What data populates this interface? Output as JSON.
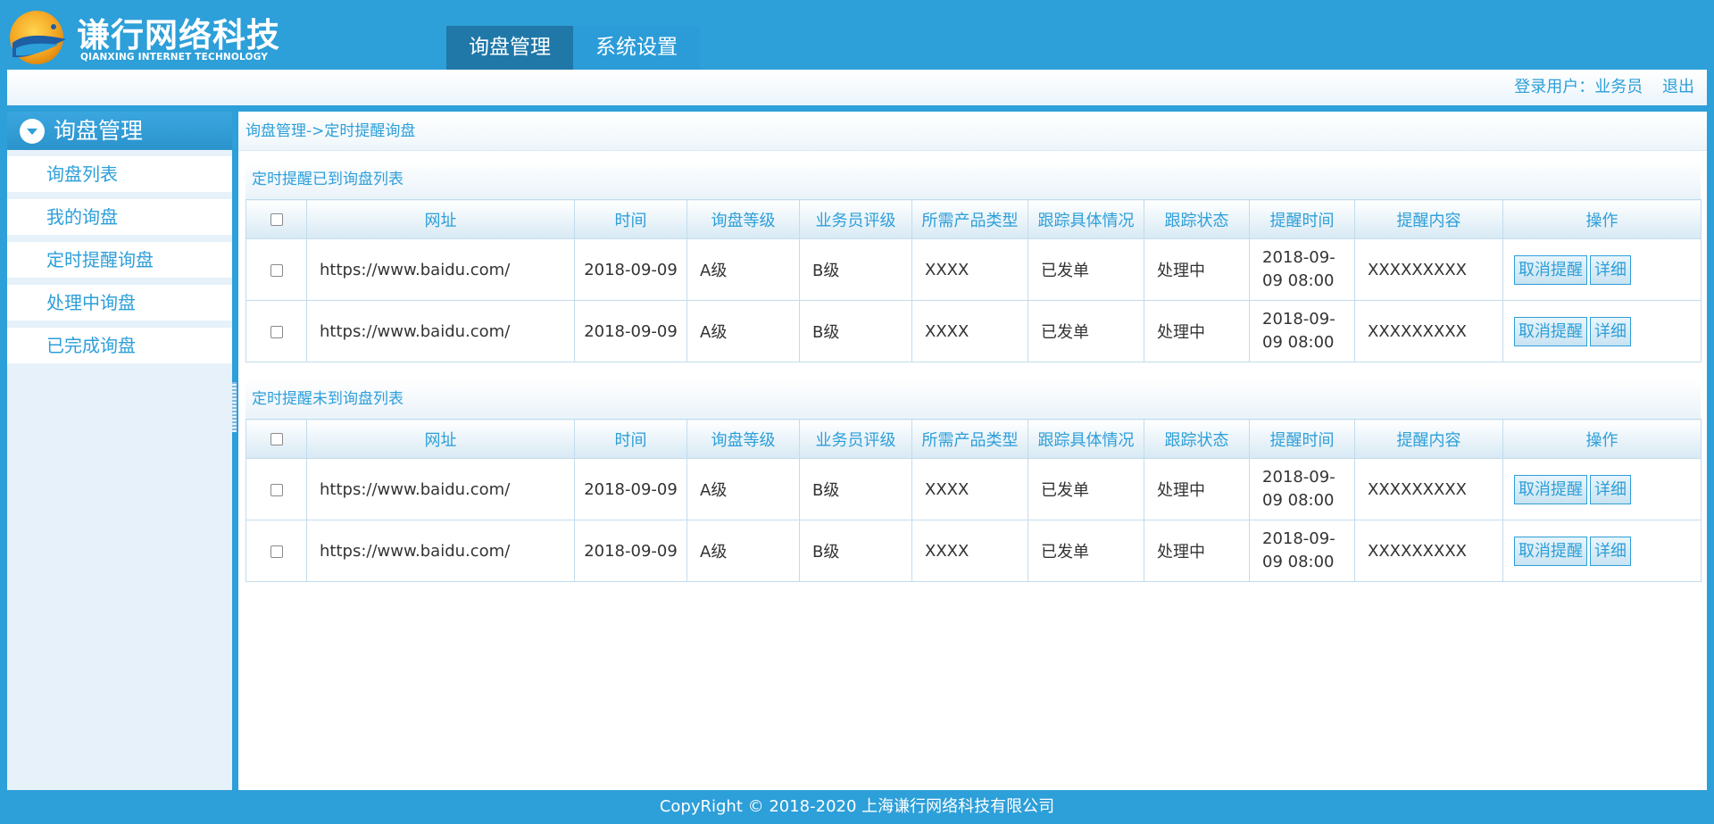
{
  "brand": {
    "name_cn": "谦行网络科技",
    "name_en": "QIANXING INTERNET TECHNOLOGY"
  },
  "top_nav": [
    {
      "label": "询盘管理",
      "active": true
    },
    {
      "label": "系统设置",
      "active": false
    }
  ],
  "userbar": {
    "user_text": "登录用户：业务员",
    "logout_label": "退出"
  },
  "sidebar": {
    "header": "询盘管理",
    "items": [
      {
        "label": "询盘列表"
      },
      {
        "label": "我的询盘"
      },
      {
        "label": "定时提醒询盘"
      },
      {
        "label": "处理中询盘"
      },
      {
        "label": "已完成询盘"
      }
    ]
  },
  "breadcrumb": "询盘管理->定时提醒询盘",
  "columns": [
    "网址",
    "时间",
    "询盘等级",
    "业务员评级",
    "所需产品类型",
    "跟踪具体情况",
    "跟踪状态",
    "提醒时间",
    "提醒内容",
    "操作"
  ],
  "actions": {
    "cancel": "取消提醒",
    "detail": "详细"
  },
  "panels": [
    {
      "title": "定时提醒已到询盘列表",
      "rows": [
        {
          "url": "https://www.baidu.com/",
          "time": "2018-09-09",
          "level": "A级",
          "rating": "B级",
          "product": "XXXX",
          "detail": "已发单",
          "status": "处理中",
          "remind_time": "2018-09-09 08:00",
          "remind_content": "XXXXXXXXX"
        },
        {
          "url": "https://www.baidu.com/",
          "time": "2018-09-09",
          "level": "A级",
          "rating": "B级",
          "product": "XXXX",
          "detail": "已发单",
          "status": "处理中",
          "remind_time": "2018-09-09 08:00",
          "remind_content": "XXXXXXXXX"
        }
      ]
    },
    {
      "title": "定时提醒未到询盘列表",
      "rows": [
        {
          "url": "https://www.baidu.com/",
          "time": "2018-09-09",
          "level": "A级",
          "rating": "B级",
          "product": "XXXX",
          "detail": "已发单",
          "status": "处理中",
          "remind_time": "2018-09-09 08:00",
          "remind_content": "XXXXXXXXX"
        },
        {
          "url": "https://www.baidu.com/",
          "time": "2018-09-09",
          "level": "A级",
          "rating": "B级",
          "product": "XXXX",
          "detail": "已发单",
          "status": "处理中",
          "remind_time": "2018-09-09 08:00",
          "remind_content": "XXXXXXXXX"
        }
      ]
    }
  ],
  "footer": "CopyRight © 2018-2020 上海谦行网络科技有限公司",
  "colors": {
    "brand_blue": "#2d9fd9",
    "active_tab": "#1f78a8",
    "sidebar_bg": "#e6f1f9",
    "logo_orange": "#f5a623"
  },
  "icons": {
    "logo": "fish-logo-icon",
    "sidebar_header": "chevron-down-circle-icon"
  }
}
